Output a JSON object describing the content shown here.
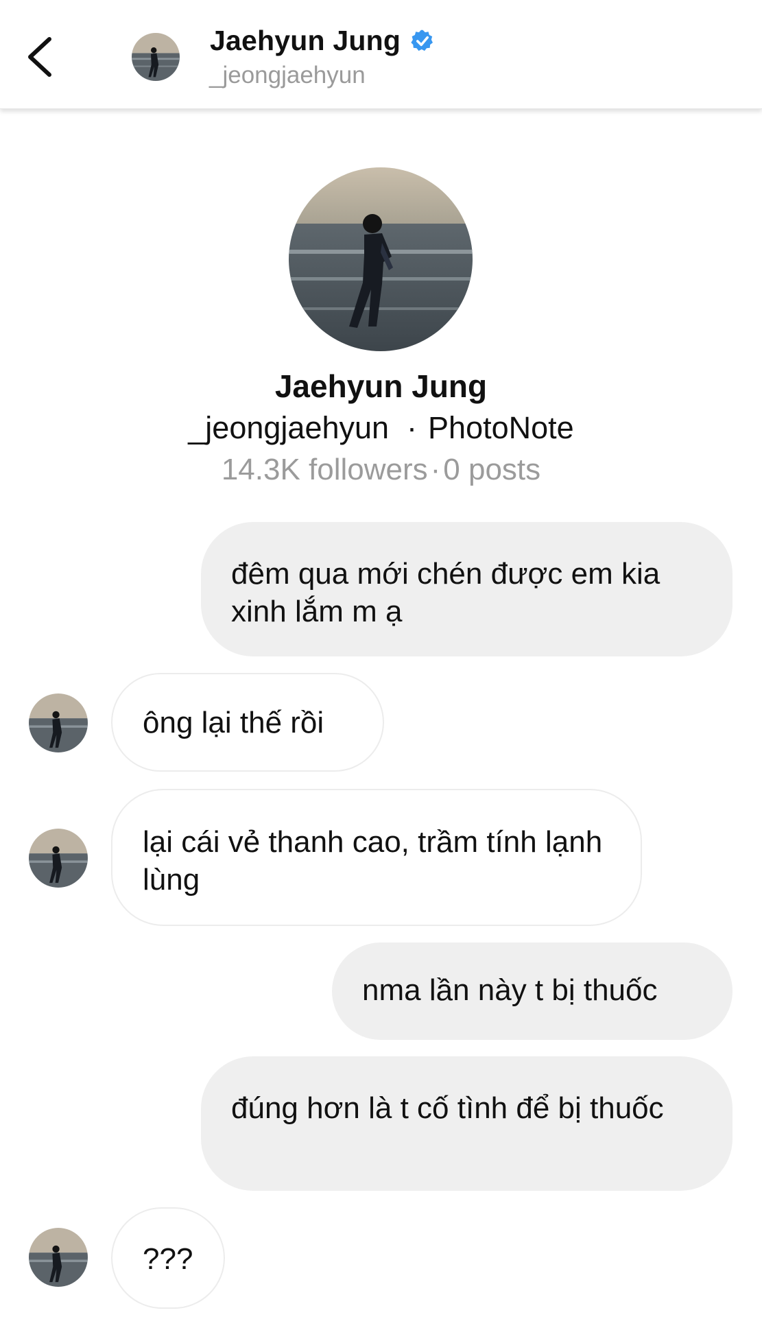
{
  "header": {
    "back_icon": "chevron-left-icon",
    "name": "Jaehyun Jung",
    "username": "_jeongjaehyun",
    "verified_color": "#3897f0"
  },
  "profile": {
    "name": "Jaehyun Jung",
    "username": "_jeongjaehyun",
    "app": "PhotoNote",
    "followers": "14.3K followers",
    "posts": "0 posts"
  },
  "messages": [
    {
      "sender": "me",
      "text": "đêm qua mới chén được em kia xinh lắm m ạ"
    },
    {
      "sender": "them",
      "text": "ông lại thế rồi"
    },
    {
      "sender": "them",
      "text": "lại cái vẻ thanh cao, trầm tính lạnh lùng"
    },
    {
      "sender": "me",
      "text": "nma lần này t bị thuốc"
    },
    {
      "sender": "me",
      "text": "đúng hơn là t cố tình để bị thuốc"
    },
    {
      "sender": "them",
      "text": "???"
    }
  ],
  "colors": {
    "outgoing_bubble": "#efefef",
    "incoming_border": "#ececec",
    "muted_text": "#9b9b9b"
  }
}
